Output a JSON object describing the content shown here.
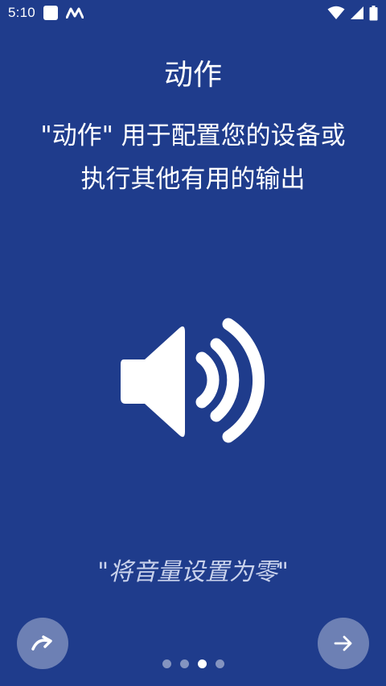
{
  "status_bar": {
    "time": "5:10",
    "icons": [
      "square-notification-icon",
      "app-logo-icon",
      "wifi-icon",
      "cellular-signal-icon",
      "battery-icon"
    ]
  },
  "intro": {
    "title": "动作",
    "description_line1": "\"动作\" 用于配置您的设备或",
    "description_line2": "执行其他有用的输出",
    "hero_icon": "speaker-volume-icon",
    "example": "\"将音量设置为零\""
  },
  "navigation": {
    "skip_icon": "redo-arrow-icon",
    "next_icon": "arrow-right-icon",
    "page_count": 4,
    "current_page": 3
  },
  "colors": {
    "background": "#1f3c8c",
    "text": "#ffffff",
    "example_text": "#c9d2ec"
  }
}
